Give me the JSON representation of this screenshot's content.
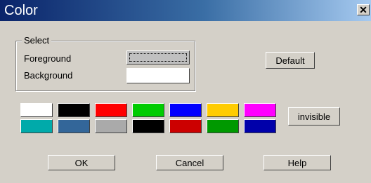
{
  "dialog": {
    "title": "Color",
    "close_glyph": "✕"
  },
  "select_group": {
    "label": "Select",
    "foreground_label": "Foreground",
    "background_label": "Background",
    "foreground_color": "#c0c0c0",
    "background_color": "#ffffff"
  },
  "buttons": {
    "default": "Default",
    "invisible": "invisible",
    "ok": "OK",
    "cancel": "Cancel",
    "help": "Help"
  },
  "palette": {
    "row1": [
      "#ffffff",
      "#000000",
      "#ff0000",
      "#00cc00",
      "#0000ff",
      "#ffcc00",
      "#ff00ff"
    ],
    "row2": [
      "#00aaaa",
      "#336699",
      "#aaaaaa",
      "#000000",
      "#cc0000",
      "#009900",
      "#0000aa"
    ]
  }
}
